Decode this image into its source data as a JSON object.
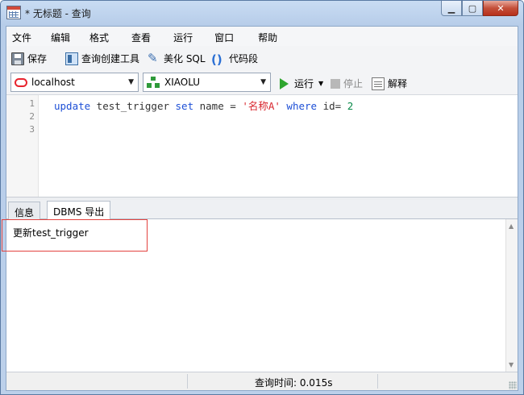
{
  "window": {
    "title": "* 无标题 - 查询"
  },
  "menu": [
    "文件",
    "编辑",
    "格式",
    "查看",
    "运行",
    "窗口",
    "帮助"
  ],
  "toolbar": {
    "save": "保存",
    "query_builder": "查询创建工具",
    "beautify": "美化 SQL",
    "snippet": "代码段"
  },
  "connection": {
    "server": "localhost",
    "schema": "XIAOLU",
    "run": "运行",
    "stop": "停止",
    "explain": "解释"
  },
  "editor": {
    "line_numbers": [
      "1",
      "2",
      "3"
    ],
    "sql": {
      "kw_update": "update",
      "table": " test_trigger ",
      "kw_set": "set",
      "col": " name = ",
      "value": "'名称A'",
      "kw_where": " where",
      "cond": " id= ",
      "id": "2"
    }
  },
  "tabs": [
    "信息",
    "DBMS 导出"
  ],
  "active_tab": "DBMS 导出",
  "output": "更新test_trigger",
  "status": {
    "query_time": "查询时间: 0.015s"
  }
}
